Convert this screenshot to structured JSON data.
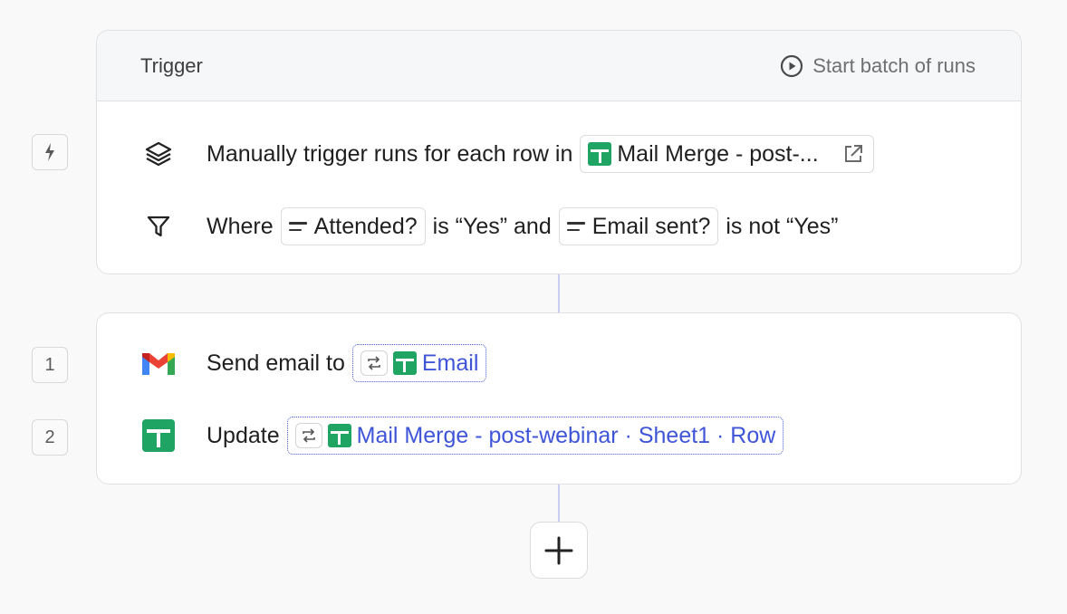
{
  "trigger": {
    "title": "Trigger",
    "start_batch_label": "Start batch of runs",
    "row1": {
      "text": "Manually trigger runs for each row in",
      "sheet_chip": "Mail Merge - post-..."
    },
    "row2": {
      "where": "Where",
      "field1": "Attended?",
      "cond1": "is “Yes” and",
      "field2": "Email sent?",
      "cond2": "is not “Yes”"
    }
  },
  "steps": [
    {
      "number": "1",
      "text": "Send email to",
      "ref": "Email"
    },
    {
      "number": "2",
      "text": "Update",
      "ref": "Mail Merge - post-webinar · Sheet1 · Row"
    }
  ],
  "colors": {
    "accent": "#3f55d8",
    "sheets_green": "#1fa463",
    "connector": "#c9cdf0"
  }
}
